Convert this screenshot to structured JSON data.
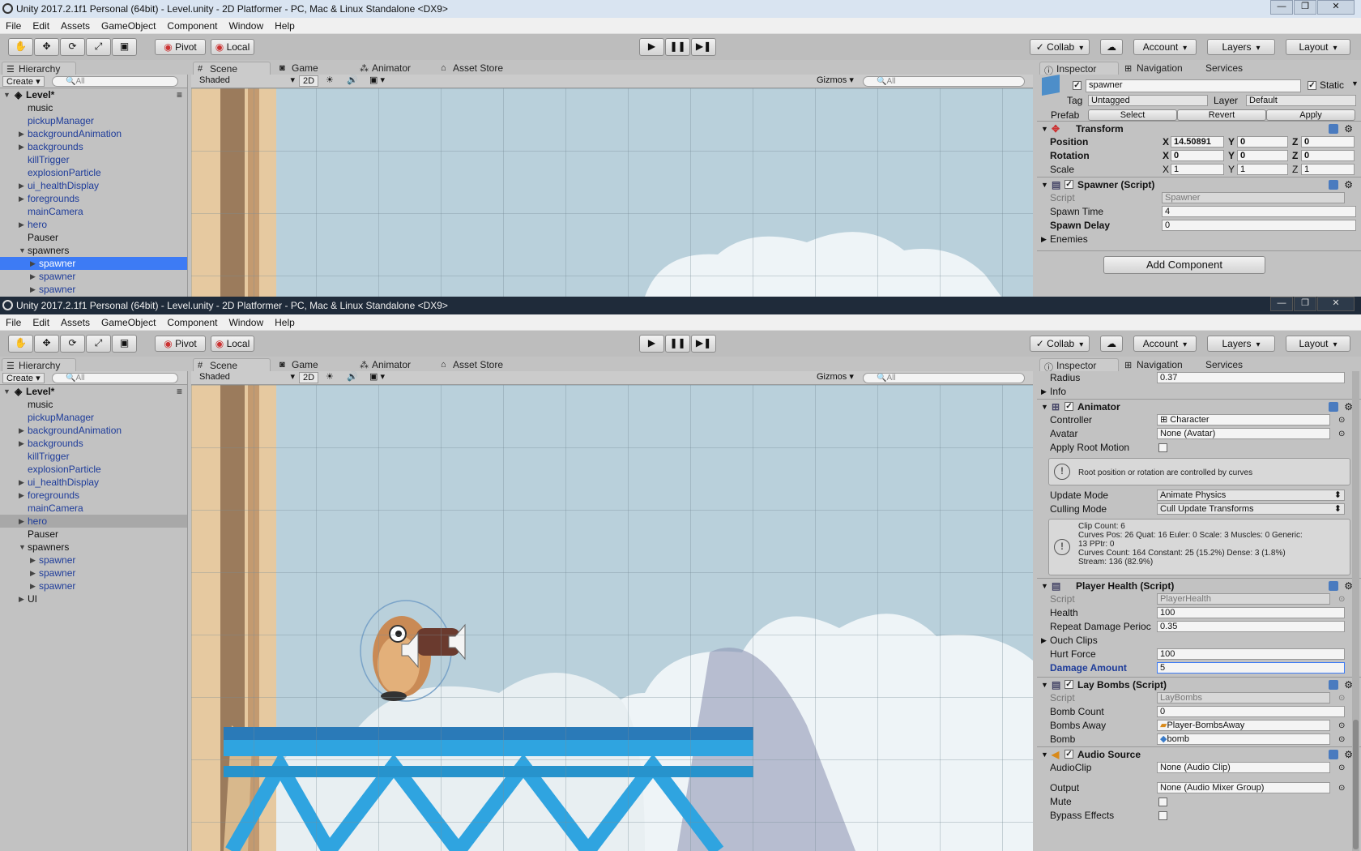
{
  "top": {
    "title": "Unity 2017.2.1f1 Personal (64bit) - Level.unity - 2D Platformer - PC, Mac & Linux Standalone <DX9>",
    "menu": [
      "File",
      "Edit",
      "Assets",
      "GameObject",
      "Component",
      "Window",
      "Help"
    ],
    "pivot": "Pivot",
    "local": "Local",
    "collab": "Collab",
    "account": "Account",
    "layers": "Layers",
    "layout": "Layout",
    "tabs": {
      "hierarchy": "Hierarchy",
      "scene": "Scene",
      "game": "Game",
      "animator": "Animator",
      "asset_store": "Asset Store",
      "inspector": "Inspector",
      "navigation": "Navigation",
      "services": "Services"
    },
    "create": "Create",
    "search_all": "All",
    "shaded": "Shaded",
    "twod": "2D",
    "gizmos": "Gizmos",
    "hierarchy": {
      "root": "Level*",
      "items": [
        {
          "label": "music",
          "arrow": "",
          "blue": false,
          "sel": false,
          "indent": 0
        },
        {
          "label": "pickupManager",
          "arrow": "",
          "blue": true,
          "sel": false,
          "indent": 0
        },
        {
          "label": "backgroundAnimation",
          "arrow": "▶",
          "blue": true,
          "sel": false,
          "indent": 0
        },
        {
          "label": "backgrounds",
          "arrow": "▶",
          "blue": true,
          "sel": false,
          "indent": 0
        },
        {
          "label": "killTrigger",
          "arrow": "",
          "blue": true,
          "sel": false,
          "indent": 0
        },
        {
          "label": "explosionParticle",
          "arrow": "",
          "blue": true,
          "sel": false,
          "indent": 0
        },
        {
          "label": "ui_healthDisplay",
          "arrow": "▶",
          "blue": true,
          "sel": false,
          "indent": 0
        },
        {
          "label": "foregrounds",
          "arrow": "▶",
          "blue": true,
          "sel": false,
          "indent": 0
        },
        {
          "label": "mainCamera",
          "arrow": "",
          "blue": true,
          "sel": false,
          "indent": 0
        },
        {
          "label": "hero",
          "arrow": "▶",
          "blue": true,
          "sel": false,
          "indent": 0
        },
        {
          "label": "Pauser",
          "arrow": "",
          "blue": false,
          "sel": false,
          "indent": 0
        },
        {
          "label": "spawners",
          "arrow": "▼",
          "blue": false,
          "sel": false,
          "indent": 0
        },
        {
          "label": "spawner",
          "arrow": "▶",
          "blue": true,
          "sel": true,
          "indent": 1
        },
        {
          "label": "spawner",
          "arrow": "▶",
          "blue": true,
          "sel": false,
          "indent": 1
        },
        {
          "label": "spawner",
          "arrow": "▶",
          "blue": true,
          "sel": false,
          "indent": 1
        }
      ]
    },
    "inspector": {
      "object_name": "spawner",
      "static_label": "Static",
      "tag_label": "Tag",
      "tag_value": "Untagged",
      "layer_label": "Layer",
      "layer_value": "Default",
      "prefab_label": "Prefab",
      "prefab_select": "Select",
      "prefab_revert": "Revert",
      "prefab_apply": "Apply",
      "transform_title": "Transform",
      "position_label": "Position",
      "rotation_label": "Rotation",
      "scale_label": "Scale",
      "pos": [
        "14.50891",
        "0",
        "0"
      ],
      "rot": [
        "0",
        "0",
        "0"
      ],
      "scl": [
        "1",
        "1",
        "1"
      ],
      "spawner_title": "Spawner (Script)",
      "script_label": "Script",
      "script_value": "Spawner",
      "spawn_time_label": "Spawn Time",
      "spawn_time": "4",
      "spawn_delay_label": "Spawn Delay",
      "spawn_delay": "0",
      "enemies_label": "Enemies",
      "add_component": "Add Component"
    }
  },
  "bottom": {
    "title": "Unity 2017.2.1f1 Personal (64bit) - Level.unity - 2D Platformer - PC, Mac & Linux Standalone <DX9>",
    "hierarchy": {
      "root": "Level*",
      "items": [
        {
          "label": "music",
          "arrow": "",
          "blue": false,
          "sel": false,
          "indent": 0
        },
        {
          "label": "pickupManager",
          "arrow": "",
          "blue": true,
          "sel": false,
          "indent": 0
        },
        {
          "label": "backgroundAnimation",
          "arrow": "▶",
          "blue": true,
          "sel": false,
          "indent": 0
        },
        {
          "label": "backgrounds",
          "arrow": "▶",
          "blue": true,
          "sel": false,
          "indent": 0
        },
        {
          "label": "killTrigger",
          "arrow": "",
          "blue": true,
          "sel": false,
          "indent": 0
        },
        {
          "label": "explosionParticle",
          "arrow": "",
          "blue": true,
          "sel": false,
          "indent": 0
        },
        {
          "label": "ui_healthDisplay",
          "arrow": "▶",
          "blue": true,
          "sel": false,
          "indent": 0
        },
        {
          "label": "foregrounds",
          "arrow": "▶",
          "blue": true,
          "sel": false,
          "indent": 0
        },
        {
          "label": "mainCamera",
          "arrow": "",
          "blue": true,
          "sel": false,
          "indent": 0
        },
        {
          "label": "hero",
          "arrow": "▶",
          "blue": true,
          "sel": false,
          "hl": true,
          "indent": 0
        },
        {
          "label": "Pauser",
          "arrow": "",
          "blue": false,
          "sel": false,
          "indent": 0
        },
        {
          "label": "spawners",
          "arrow": "▼",
          "blue": false,
          "sel": false,
          "indent": 0
        },
        {
          "label": "spawner",
          "arrow": "▶",
          "blue": true,
          "sel": false,
          "indent": 1
        },
        {
          "label": "spawner",
          "arrow": "▶",
          "blue": true,
          "sel": false,
          "indent": 1
        },
        {
          "label": "spawner",
          "arrow": "▶",
          "blue": true,
          "sel": false,
          "indent": 1
        },
        {
          "label": "UI",
          "arrow": "▶",
          "blue": false,
          "sel": false,
          "indent": 0
        }
      ]
    },
    "inspector": {
      "radius_label": "Radius",
      "radius": "0.37",
      "info_label": "Info",
      "animator_title": "Animator",
      "controller_label": "Controller",
      "controller": "Character",
      "avatar_label": "Avatar",
      "avatar": "None (Avatar)",
      "apply_root_label": "Apply Root Motion",
      "root_info": "Root position or rotation are controlled by curves",
      "update_mode_label": "Update Mode",
      "update_mode": "Animate Physics",
      "culling_label": "Culling Mode",
      "culling": "Cull Update Transforms",
      "clip_info": [
        "Clip Count: 6",
        "Curves Pos: 26 Quat: 16 Euler: 0 Scale: 3 Muscles: 0 Generic:",
        "13 PPtr: 0",
        "Curves Count: 164 Constant: 25 (15.2%) Dense: 3 (1.8%)",
        "Stream: 136 (82.9%)"
      ],
      "health_title": "Player Health (Script)",
      "script_label": "Script",
      "health_script": "PlayerHealth",
      "health_label": "Health",
      "health": "100",
      "repeat_label": "Repeat Damage Perioc",
      "repeat": "0.35",
      "ouch_label": "Ouch Clips",
      "hurt_label": "Hurt Force",
      "hurt": "100",
      "damage_label": "Damage Amount",
      "damage": "5",
      "bombs_title": "Lay Bombs (Script)",
      "bombs_script": "LayBombs",
      "bomb_count_label": "Bomb Count",
      "bomb_count": "0",
      "bombs_away_label": "Bombs Away",
      "bombs_away": "Player-BombsAway",
      "bomb_label": "Bomb",
      "bomb": "bomb",
      "audio_title": "Audio Source",
      "audioclip_label": "AudioClip",
      "audioclip": "None (Audio Clip)",
      "output_label": "Output",
      "output": "None (Audio Mixer Group)",
      "mute_label": "Mute",
      "bypass_label": "Bypass Effects"
    }
  }
}
